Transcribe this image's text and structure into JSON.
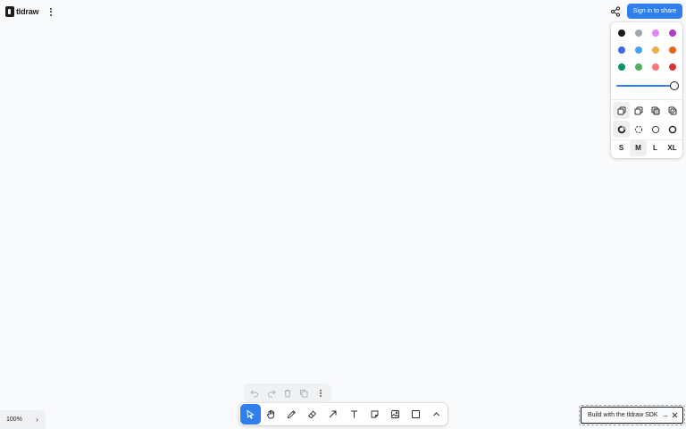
{
  "brand": {
    "name": "tldraw",
    "icon": "tldraw-logo-icon",
    "menu_icon": "dots-vertical-icon"
  },
  "header": {
    "share_icon": "share-icon",
    "sign_in_label": "Sign in to share"
  },
  "style_panel": {
    "colors": [
      {
        "name": "black",
        "hex": "#1d1d1d"
      },
      {
        "name": "grey",
        "hex": "#9fa8b2"
      },
      {
        "name": "light-violet",
        "hex": "#e085f4"
      },
      {
        "name": "violet",
        "hex": "#ae3ec9"
      },
      {
        "name": "blue",
        "hex": "#4465e9"
      },
      {
        "name": "light-blue",
        "hex": "#4ba1f1"
      },
      {
        "name": "yellow",
        "hex": "#f1ac4b"
      },
      {
        "name": "orange",
        "hex": "#e16919"
      },
      {
        "name": "green",
        "hex": "#099268"
      },
      {
        "name": "light-green",
        "hex": "#4cb05e"
      },
      {
        "name": "light-red",
        "hex": "#f87777"
      },
      {
        "name": "red",
        "hex": "#e03131"
      }
    ],
    "opacity": 1.0,
    "fill_options": [
      "fill-none-icon",
      "fill-semi-icon",
      "fill-solid-icon",
      "fill-pattern-icon"
    ],
    "fill_selected": 0,
    "dash_options": [
      "dash-draw-icon",
      "dash-dashed-icon",
      "dash-dotted-icon",
      "dash-solid-icon"
    ],
    "dash_selected": 0,
    "sizes": [
      "S",
      "M",
      "L",
      "XL"
    ],
    "size_selected": 1
  },
  "zoom": {
    "label": "100%",
    "chevron": "›"
  },
  "actions": [
    "undo-icon",
    "redo-icon",
    "trash-icon",
    "duplicate-icon",
    "more-icon"
  ],
  "tools": [
    {
      "name": "select",
      "icon": "cursor-icon",
      "active": true
    },
    {
      "name": "hand",
      "icon": "hand-icon",
      "active": false
    },
    {
      "name": "draw",
      "icon": "pencil-icon",
      "active": false
    },
    {
      "name": "eraser",
      "icon": "eraser-icon",
      "active": false
    },
    {
      "name": "arrow",
      "icon": "arrow-icon",
      "active": false
    },
    {
      "name": "text",
      "icon": "text-icon",
      "active": false
    },
    {
      "name": "note",
      "icon": "note-icon",
      "active": false
    },
    {
      "name": "asset",
      "icon": "image-icon",
      "active": false
    },
    {
      "name": "rectangle",
      "icon": "rectangle-icon",
      "active": false
    },
    {
      "name": "more-tools",
      "icon": "chevron-up-icon",
      "active": false
    }
  ],
  "sdk_link": {
    "label": "Build with the tldraw SDK",
    "arrow": "→",
    "close_icon": "close-icon"
  }
}
